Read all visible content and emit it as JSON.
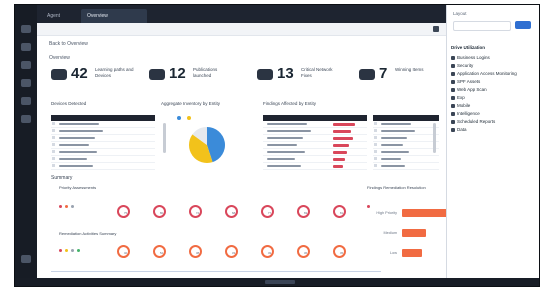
{
  "window": {
    "tabs": [
      {
        "label": "Agent"
      },
      {
        "label": "Overview"
      },
      {
        "label": ""
      }
    ]
  },
  "toolbar": {
    "breadcrumb": ""
  },
  "dashboard": {
    "back_link": "Back to Overview",
    "overview_label": "Overview",
    "stats": [
      {
        "value": "42",
        "label": "Learning paths and Devices",
        "icon": "car-icon"
      },
      {
        "value": "12",
        "label": "Publications launched",
        "icon": "mail-icon"
      },
      {
        "value": "13",
        "label": "Critical Network Fixes",
        "icon": "network-icon"
      },
      {
        "value": "7",
        "label": "Winning Items",
        "icon": "monitor-icon"
      }
    ],
    "panel_titles": {
      "left": "Devices Detected",
      "middle": "Aggregate Inventory by Entity",
      "right": "Findings Affected by Entity"
    },
    "pie": {
      "slices": [
        {
          "label": "Blue",
          "value": 45,
          "color": "#3b8bd9"
        },
        {
          "label": "Yellow",
          "value": 40,
          "color": "#f2c21b"
        },
        {
          "label": "Gray",
          "value": 15,
          "color": "#e6e9ee"
        }
      ]
    },
    "sections": {
      "summary": "Summary",
      "row1": "Priority Assessments",
      "row2": "Remediation Activities Summary",
      "right": "Findings Remediation Resolution"
    },
    "rings_row1": [
      {
        "value": "75"
      },
      {
        "value": "80"
      },
      {
        "value": "72"
      },
      {
        "value": "68"
      },
      {
        "value": "77"
      },
      {
        "value": "69"
      },
      {
        "value": "81"
      }
    ],
    "rings_row2": [
      {
        "value": "40"
      },
      {
        "value": "52"
      },
      {
        "value": "38"
      },
      {
        "value": "33"
      },
      {
        "value": "49"
      },
      {
        "value": "36"
      },
      {
        "value": "45"
      }
    ],
    "hbars": [
      {
        "label": "High Priority",
        "value": 100
      },
      {
        "label": "Medium",
        "value": 48
      },
      {
        "label": "Low",
        "value": 40
      }
    ],
    "footer_axis": ""
  },
  "right_pane": {
    "title": "Layout",
    "section": "Drive Utilization",
    "items": [
      "Business Logins",
      "Security",
      "Application Access Monitoring",
      "SPF Assets",
      "Web App Scan",
      "Exp",
      "Mobile",
      "Intelligence",
      "Scheduled Reports",
      "Data"
    ]
  },
  "colors": {
    "accent_red": "#d9475b",
    "accent_orange": "#f16b42",
    "ring_green": "#45b36b",
    "dark": "#1f2430"
  }
}
